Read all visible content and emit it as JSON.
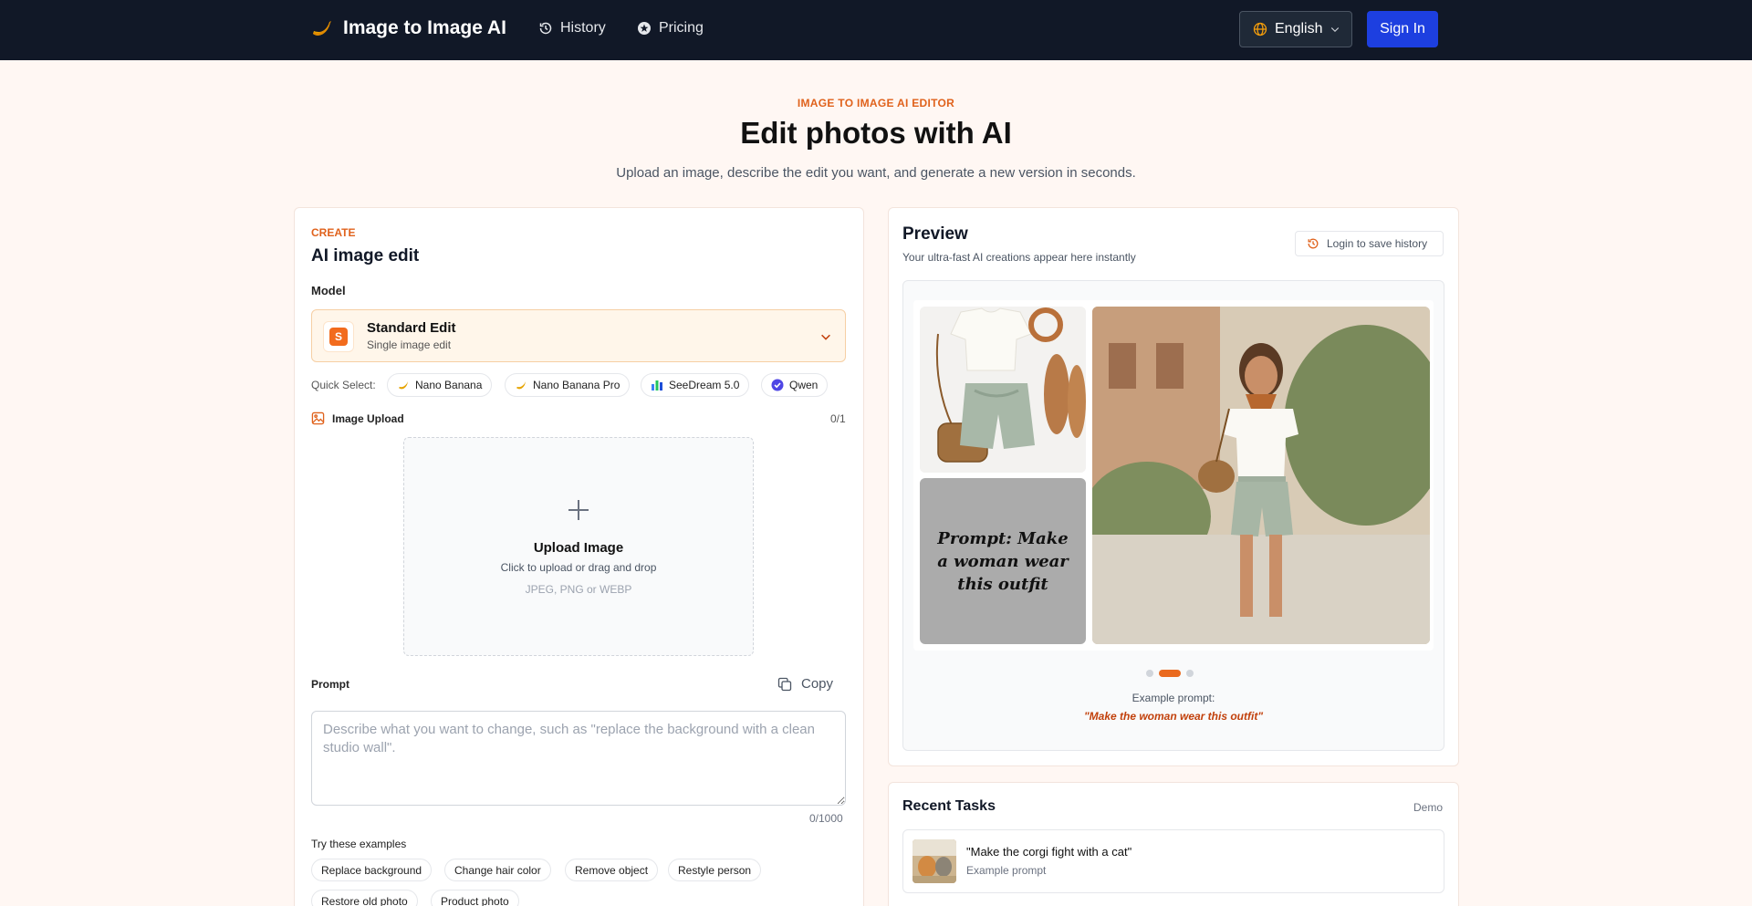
{
  "nav": {
    "brand": "Image to Image AI",
    "links": [
      {
        "label": "History",
        "icon": "history-icon"
      },
      {
        "label": "Pricing",
        "icon": "pricing-icon"
      }
    ],
    "language": "English",
    "sign_in": "Sign In"
  },
  "hero": {
    "eyebrow": "IMAGE TO IMAGE AI EDITOR",
    "title": "Edit photos with AI",
    "subtitle": "Upload an image, describe the edit you want, and generate a new version in seconds."
  },
  "editor": {
    "section_label": "CREATE",
    "title": "AI image edit",
    "model_label": "Model",
    "model": {
      "badge": "S",
      "name": "Standard Edit",
      "description": "Single image edit"
    },
    "quick_select_label": "Quick Select:",
    "quick_select": [
      {
        "label": "Nano Banana",
        "icon": "banana-icon"
      },
      {
        "label": "Nano Banana Pro",
        "icon": "banana-icon"
      },
      {
        "label": "SeeDream 5.0",
        "icon": "bar-chart-icon"
      },
      {
        "label": "Qwen",
        "icon": "qwen-icon"
      }
    ],
    "upload_label": "Image Upload",
    "upload_count": "0/1",
    "dropzone": {
      "title": "Upload Image",
      "subtitle": "Click to upload or drag and drop",
      "types": "JPEG, PNG or WEBP"
    },
    "prompt_label": "Prompt",
    "copy_label": "Copy",
    "prompt_value": "",
    "prompt_placeholder": "Describe what you want to change, such as \"replace the background with a clean studio wall\".",
    "prompt_count": "0/1000",
    "examples_label": "Try these examples",
    "examples": [
      "Replace background",
      "Change hair color",
      "Remove object",
      "Restyle person",
      "Restore old photo",
      "Product photo"
    ]
  },
  "preview": {
    "title": "Preview",
    "subtitle": "Your ultra-fast AI creations appear here instantly",
    "login_button": "Login to save history",
    "prompt_tile": "Prompt: Make a woman wear this outfit",
    "example_label": "Example prompt:",
    "example_text": "\"Make the woman wear this outfit\"",
    "slide_count": 3,
    "active_slide": 2
  },
  "tasks": {
    "title": "Recent Tasks",
    "badge": "Demo",
    "items": [
      {
        "text": "\"Make the corgi fight with a cat\"",
        "sub": "Example prompt"
      }
    ]
  },
  "colors": {
    "nav_bg": "#111827",
    "accent": "#e0621c",
    "primary_button": "#1d3fe0",
    "page_bg": "#fff7f3"
  }
}
